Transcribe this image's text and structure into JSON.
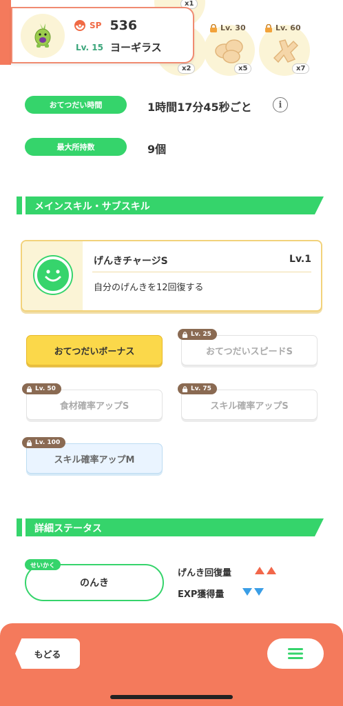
{
  "colors": {
    "accent_orange": "#f47a5c",
    "accent_green": "#35d46b",
    "gold": "#fbd84a",
    "up_arrow": "#f2674a",
    "down_arrow": "#3a9ee6"
  },
  "pokemon": {
    "sp_label": "SP",
    "sp_value": "536",
    "level": "Lv. 15",
    "name": "ヨーギラス"
  },
  "ingredients": [
    {
      "multiplier": "x1",
      "lock": ""
    },
    {
      "multiplier": "x2",
      "lock": ""
    },
    {
      "multiplier": "x5",
      "lock": "Lv. 30"
    },
    {
      "multiplier": "x7",
      "lock": "Lv. 60"
    }
  ],
  "stats": {
    "help_time_label": "おてつだい時間",
    "help_time_value": "1時間17分45秒ごと",
    "max_carry_label": "最大所持数",
    "max_carry_value": "9個"
  },
  "skills_section": {
    "title": "メインスキル・サブスキル",
    "main_skill": {
      "name": "げんきチャージS",
      "level": "Lv.1",
      "description": "自分のげんきを12回復する",
      "icon": "smile-face-icon"
    },
    "sub_skills": [
      {
        "label": "おてつだいボーナス",
        "state": "active",
        "lock": ""
      },
      {
        "label": "おてつだいスピードS",
        "state": "locked",
        "lock": "Lv. 25"
      },
      {
        "label": "食材確率アップS",
        "state": "locked",
        "lock": "Lv. 50"
      },
      {
        "label": "スキル確率アップS",
        "state": "locked",
        "lock": "Lv. 75"
      },
      {
        "label": "スキル確率アップM",
        "state": "blue",
        "lock": "Lv. 100"
      }
    ]
  },
  "details_section": {
    "title": "詳細ステータス",
    "nature_tag": "せいかく",
    "nature": "のんき",
    "effects": [
      {
        "label": "げんき回復量",
        "direction": "up"
      },
      {
        "label": "EXP獲得量",
        "direction": "down"
      }
    ]
  },
  "footer": {
    "back_label": "もどる",
    "menu_icon": "hamburger-menu-icon"
  }
}
